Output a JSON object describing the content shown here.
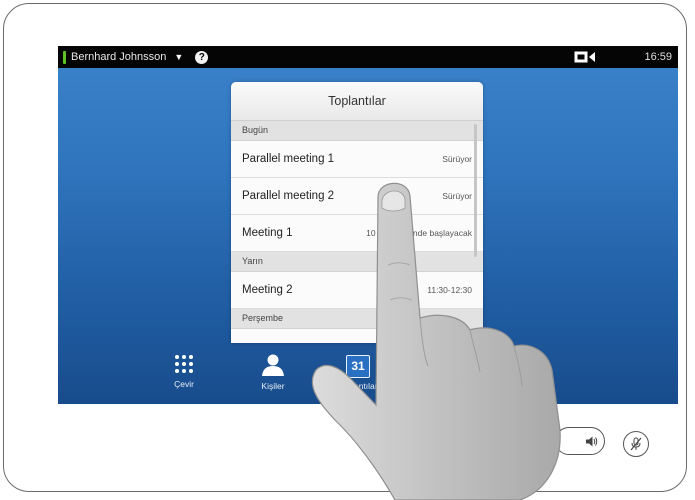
{
  "status_bar": {
    "user_name": "Bernhard Johnsson",
    "caret": "▼",
    "help_symbol": "?",
    "clock": "16:59",
    "presence_color": "#5ec225"
  },
  "meetings_panel": {
    "title": "Toplantılar",
    "sections": [
      {
        "label": "Bugün"
      },
      {
        "label": "Yarın"
      },
      {
        "label": "Perşembe"
      }
    ],
    "rows": [
      {
        "name": "Parallel meeting 1",
        "status": "Sürüyor"
      },
      {
        "name": "Parallel meeting 2",
        "status": "Sürüyor"
      },
      {
        "name": "Meeting 1",
        "status": "10 dakika içinde başlayacak"
      },
      {
        "name": "Meeting 2",
        "status": "11:30-12:30"
      }
    ]
  },
  "dock": {
    "dial_label": "Çevir",
    "contacts_label": "Kişiler",
    "meetings_label": "Toplantılar",
    "calendar_day": "31"
  },
  "controls": {
    "volume_icon": "speaker-icon",
    "mute_icon": "microphone-muted-icon"
  }
}
